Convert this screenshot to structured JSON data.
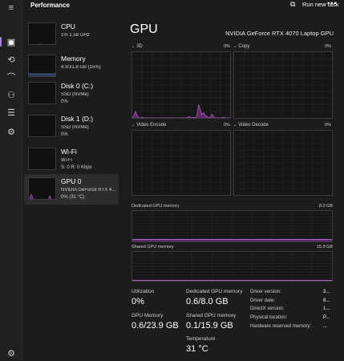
{
  "app": {
    "title": "Performance"
  },
  "nav": {
    "items": [
      {
        "name": "hamburger-icon",
        "glyph": "≡"
      },
      {
        "name": "performance-icon",
        "glyph": "▣"
      },
      {
        "name": "history-icon",
        "glyph": "⟲"
      },
      {
        "name": "startup-icon",
        "glyph": "⌒"
      },
      {
        "name": "users-icon",
        "glyph": "⚇"
      },
      {
        "name": "details-icon",
        "glyph": "☰"
      },
      {
        "name": "services-icon",
        "glyph": "⚙"
      }
    ],
    "settings_glyph": "⚙"
  },
  "header": {
    "run_new_task": "Run new task",
    "run_icon_glyph": "⧉",
    "more_glyph": "•••"
  },
  "sidebar": {
    "cards": [
      {
        "name": "CPU",
        "sub1": "1%  1.58 GHz",
        "sub2": ""
      },
      {
        "name": "Memory",
        "sub1": "4.9/31.8 GB (15%)",
        "sub2": ""
      },
      {
        "name": "Disk 0 (C:)",
        "sub1": "SSD (NVMe)",
        "sub2": "0%"
      },
      {
        "name": "Disk 1 (D:)",
        "sub1": "SSD (NVMe)",
        "sub2": "0%"
      },
      {
        "name": "Wi-Fi",
        "sub1": "Wi-Fi",
        "sub2": "S: 0  R: 0 Kbps"
      },
      {
        "name": "GPU 0",
        "sub1": "NVIDIA GeForce RTX 4...",
        "sub2": "0% (31 °C)"
      }
    ]
  },
  "main": {
    "title": "GPU",
    "model": "NVIDIA GeForce RTX 4070 Laptop GPU",
    "graphs": [
      {
        "label": "3D",
        "pct": "0%"
      },
      {
        "label": "Copy",
        "pct": "0%"
      },
      {
        "label": "Video Encode",
        "pct": "0%"
      },
      {
        "label": "Video Decode",
        "pct": "0%"
      }
    ],
    "dedicated": {
      "label": "Dedicated GPU memory",
      "max": "8.0 GB",
      "usage_fraction": 0.075
    },
    "shared": {
      "label": "Shared GPU memory",
      "max": "15.9 GB",
      "usage_fraction": 0.006
    },
    "stats": {
      "utilization_label": "Utilization",
      "utilization": "0%",
      "dedicated_label": "Dedicated GPU memory",
      "dedicated": "0.6/8.0 GB",
      "gpu_memory_label": "GPU Memory",
      "gpu_memory": "0.6/23.9 GB",
      "shared_label": "Shared GPU memory",
      "shared": "0.1/15.9 GB",
      "temperature_label": "Temperature",
      "temperature": "31 °C"
    },
    "properties": [
      {
        "key": "Driver version:",
        "value": "3..."
      },
      {
        "key": "Driver date:",
        "value": "8..."
      },
      {
        "key": "DirectX version:",
        "value": "1..."
      },
      {
        "key": "Physical location:",
        "value": "P..."
      },
      {
        "key": "Hardware reserved memory:",
        "value": "..."
      }
    ]
  },
  "colors": {
    "accent": "#a682d6",
    "gpu_line": "#b35fc7",
    "gpu_fill": "#5b2a66",
    "border": "#3b3b3b"
  },
  "chart_data": {
    "type": "area",
    "title": "3D",
    "ylim": [
      0,
      100
    ],
    "x": [
      0,
      1,
      2,
      3,
      4,
      5,
      6,
      7,
      8,
      9,
      10,
      11,
      12,
      13,
      14,
      15,
      16,
      17,
      18,
      19,
      20,
      21,
      22,
      23,
      24,
      25,
      26,
      27,
      28,
      29,
      30,
      31,
      32,
      33,
      34,
      35,
      36,
      37,
      38,
      39,
      40,
      41,
      42,
      43,
      44,
      45,
      46,
      47,
      48,
      49,
      50,
      51,
      52,
      53,
      54,
      55,
      56,
      57,
      58,
      59
    ],
    "values": [
      0,
      4,
      10,
      3,
      0,
      0,
      1,
      0,
      0,
      0,
      0,
      0,
      0,
      0,
      0,
      0,
      0,
      0,
      0,
      0,
      0,
      0,
      0,
      0,
      0,
      0,
      0,
      0,
      0,
      0,
      0,
      0,
      0,
      0,
      2,
      1,
      0,
      1,
      0,
      4,
      20,
      12,
      5,
      8,
      4,
      2,
      1,
      0,
      6,
      2,
      0,
      0,
      0,
      0,
      0,
      1,
      0,
      0,
      0,
      0
    ]
  }
}
